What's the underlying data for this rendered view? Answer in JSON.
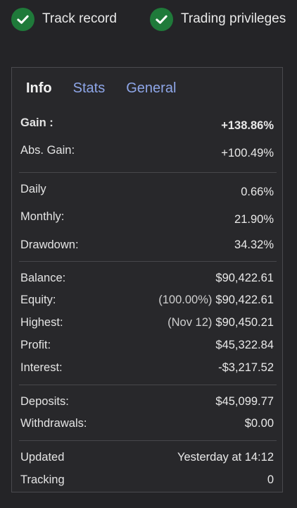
{
  "badges": [
    {
      "label": "Track record"
    },
    {
      "label": "Trading privileges"
    }
  ],
  "tabs": [
    {
      "label": "Info"
    },
    {
      "label": "Stats"
    },
    {
      "label": "General"
    }
  ],
  "gain": {
    "label": "Gain :",
    "value": "+138.86%"
  },
  "abs_gain": {
    "label": "Abs. Gain:",
    "value": "+100.49%"
  },
  "daily": {
    "label": "Daily",
    "value": "0.66%"
  },
  "monthly": {
    "label": "Monthly:",
    "value": "21.90%"
  },
  "drawdown": {
    "label": "Drawdown:",
    "value": "34.32%"
  },
  "balance": {
    "label": "Balance:",
    "value": "$90,422.61"
  },
  "equity": {
    "label": "Equity:",
    "prefix": "(100.00%)",
    "value": "$90,422.61"
  },
  "highest": {
    "label": "Highest:",
    "prefix": "(Nov 12)",
    "value": "$90,450.21"
  },
  "profit": {
    "label": "Profit:",
    "value": "$45,322.84"
  },
  "interest": {
    "label": "Interest:",
    "value": "-$3,217.52"
  },
  "deposits": {
    "label": "Deposits:",
    "value": "$45,099.77"
  },
  "withdrawals": {
    "label": "Withdrawals:",
    "value": "$0.00"
  },
  "updated": {
    "label": "Updated",
    "value": "Yesterday at 14:12"
  },
  "tracking": {
    "label": "Tracking",
    "value": "0"
  },
  "colors": {
    "check_badge": "#1f7a3a",
    "tab_link": "#8ea6e8",
    "background": "#242427"
  }
}
